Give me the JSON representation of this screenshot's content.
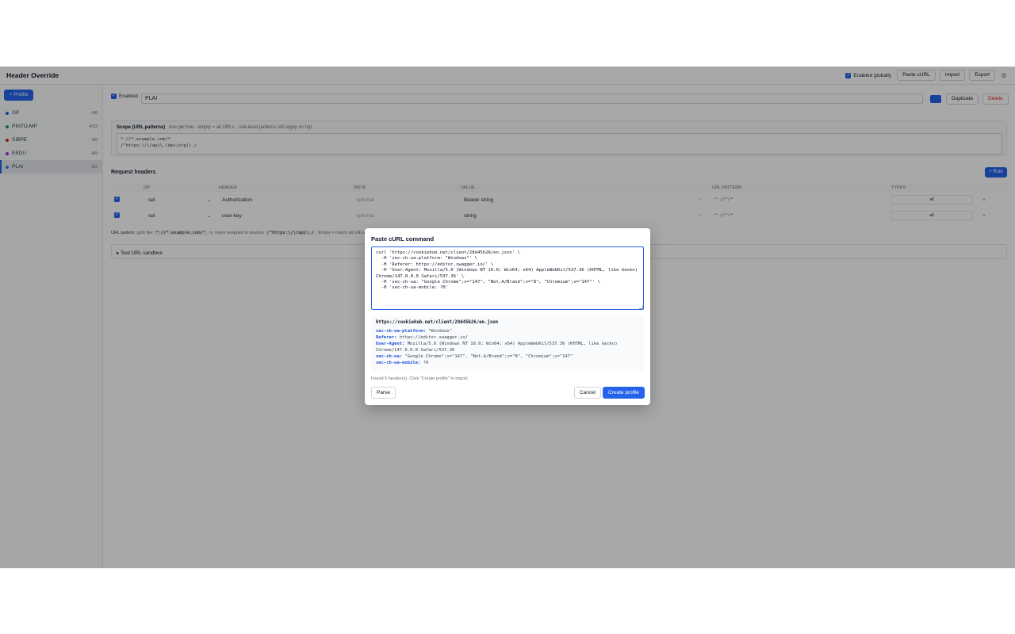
{
  "app": {
    "title": "Header Override"
  },
  "topbar": {
    "enabled_globally": "Enabled globally",
    "paste_curl": "Paste cURL",
    "import": "Import",
    "export": "Export",
    "settings_icon": "gear-icon"
  },
  "sidebar": {
    "add_profile": "+ Profile",
    "profiles": [
      {
        "name": "GP",
        "count": "4/8",
        "color": "#2563eb"
      },
      {
        "name": "PINTO-MP",
        "count": "4/13",
        "color": "#16a34a"
      },
      {
        "name": "SIBPE",
        "count": "4/9",
        "color": "#dc2626"
      },
      {
        "name": "EEDU",
        "count": "4/9",
        "color": "#9333ea"
      },
      {
        "name": "PLAI",
        "count": "2/2",
        "color": "#3b82f6",
        "active": true
      }
    ]
  },
  "profile": {
    "enabled_label": "Enabled",
    "name": "PLAI",
    "color": "#2563eb",
    "duplicate": "Duplicate",
    "delete": "Delete"
  },
  "scope": {
    "title": "Scope (URL patterns)",
    "hint": "one per line · empty = all URLs · rule-level patterns still apply on top",
    "line1": "*://*.example.com/*",
    "line2": "/^https:\\/\\/api\\.(dev|stg)\\./"
  },
  "headers": {
    "title": "Request headers",
    "add_rule": "+ Rule",
    "columns": {
      "op": "OP",
      "header": "HEADER",
      "note": "NOTE",
      "value": "VALUE",
      "url_pattern": "URL PATTERN",
      "types": "TYPES"
    },
    "rows": [
      {
        "op": "set",
        "header": "Authorization",
        "note": "optional",
        "value": "Bearer string",
        "url_pattern": "*://*/*",
        "types": "all"
      },
      {
        "op": "set",
        "header": "user-key",
        "note": "optional",
        "value": "string",
        "url_pattern": "*://*/*",
        "types": "all"
      }
    ],
    "url_pattern_help": {
      "label": "URL pattern:",
      "text1": "glob like",
      "code1": "*://*.example.com/*",
      "text2": ", or regex wrapped in slashes",
      "code2": "/^https:\\/\\/api\\./",
      "text3": ". Empty = match all URLs."
    },
    "sandbox": "▸ Test URL sandbox"
  },
  "modal": {
    "title": "Paste cURL command",
    "curl_text": "curl 'https://cookiehub.net/client/28d45b26/en.json' \\\n  -H 'sec-ch-ua-platform: \"Windows\"' \\\n  -H 'Referer: https://editor.swagger.io/' \\\n  -H 'User-Agent: Mozilla/5.0 (Windows NT 10.0; Win64; x64) AppleWebKit/537.36 (KHTML, like Gecko)\nChrome/147.0.0.0 Safari/537.36' \\\n  -H 'sec-ch-ua: \"Google Chrome\";v=\"147\", \"Not.A/Brand\";v=\"8\", \"Chromium\";v=\"147\"' \\\n  -H 'sec-ch-ua-mobile: ?0'",
    "preview": {
      "url": "https://cookiehub.net/client/28d45b26/en.json",
      "headers": [
        {
          "key": "sec-ch-ua-platform:",
          "value": "\"Windows\""
        },
        {
          "key": "Referer:",
          "value": "https://editor.swagger.io/"
        },
        {
          "key": "User-Agent:",
          "value": "Mozilla/5.0 (Windows NT 10.0; Win64; x64) AppleWebKit/537.36 (KHTML, like Gecko) Chrome/147.0.0.0 Safari/537.36"
        },
        {
          "key": "sec-ch-ua:",
          "value": "\"Google Chrome\";v=\"147\", \"Not.A/Brand\";v=\"8\", \"Chromium\";v=\"147\""
        },
        {
          "key": "sec-ch-ua-mobile:",
          "value": "?0"
        }
      ]
    },
    "status": "Found 5 header(s). Click \"Create profile\" to import.",
    "parse": "Parse",
    "cancel": "Cancel",
    "create": "Create profile"
  }
}
